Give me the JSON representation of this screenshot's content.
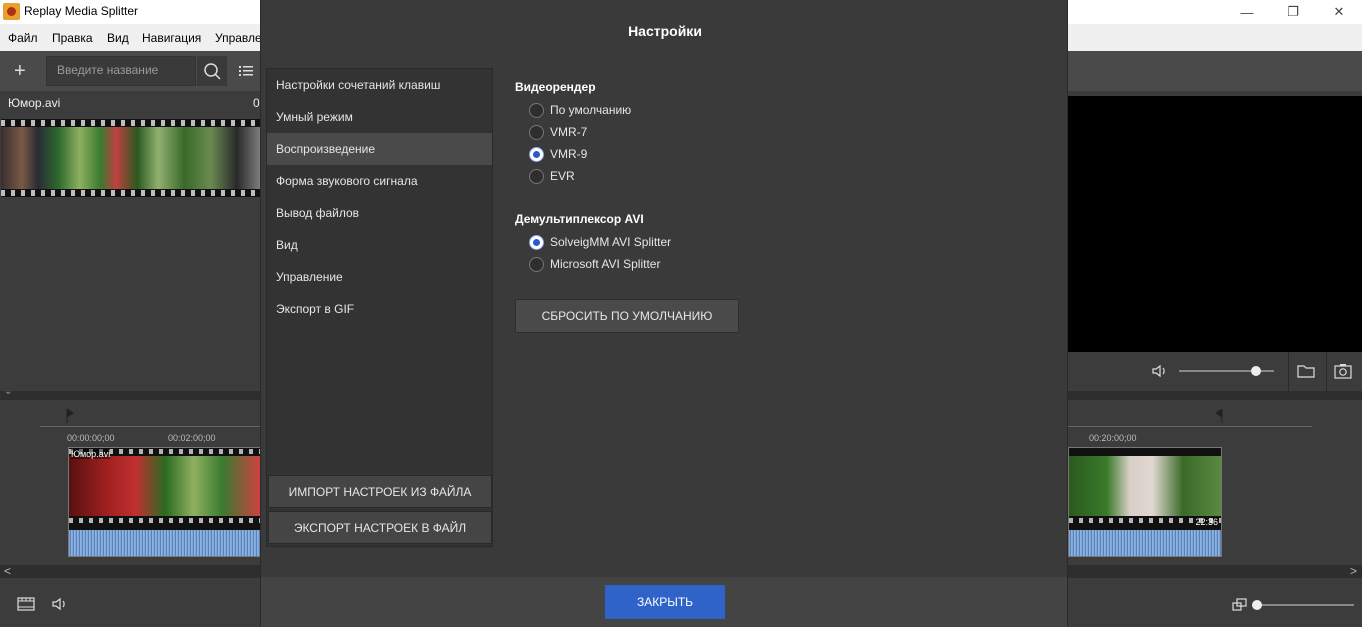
{
  "window": {
    "title": "Replay Media Splitter",
    "minimize_glyph": "—",
    "maximize_glyph": "❐",
    "close_glyph": "✕"
  },
  "menu": {
    "items": [
      "Файл",
      "Правка",
      "Вид",
      "Навигация",
      "Управле"
    ]
  },
  "toolbar": {
    "add_glyph": "+",
    "search_placeholder": "Введите название"
  },
  "media": {
    "file_name": "Юмор.avi",
    "counter": "0"
  },
  "timeline": {
    "ticks": [
      "00:00:00;00",
      "00:02:00;00",
      "00:20:00;00"
    ],
    "clip_name": "Юмор.avi",
    "clip_duration": "22:36",
    "scroll_left": "<",
    "scroll_right": ">",
    "collapse_glyph": "⌄"
  },
  "dialog": {
    "title": "Настройки",
    "nav": [
      "Настройки сочетаний клавиш",
      "Умный режим",
      "Воспроизведение",
      "Форма звукового сигнала",
      "Вывод файлов",
      "Вид",
      "Управление",
      "Экспорт в GIF"
    ],
    "active_nav_index": 2,
    "import_button": "ИМПОРТ НАСТРОЕК ИЗ ФАЙЛА",
    "export_button": "ЭКСПОРТ НАСТРОЕК В ФАЙЛ",
    "video_renderer": {
      "title": "Видеорендер",
      "options": [
        "По умолчанию",
        "VMR-7",
        "VMR-9",
        "EVR"
      ],
      "selected": "VMR-9"
    },
    "avi_demuxer": {
      "title": "Демультиплексор AVI",
      "options": [
        "SolveigMM AVI Splitter",
        "Microsoft AVI Splitter"
      ],
      "selected": "SolveigMM AVI Splitter"
    },
    "reset_button": "СБРОСИТЬ ПО УМОЛЧАНИЮ",
    "close_button": "ЗАКРЫТЬ"
  },
  "player": {
    "volume_level": 0.8
  },
  "zoom": {
    "level": 0.0
  },
  "colors": {
    "accent": "#2f63c9",
    "dialog_bg": "#3a3a3a",
    "waveform": "#7fa8d8"
  }
}
